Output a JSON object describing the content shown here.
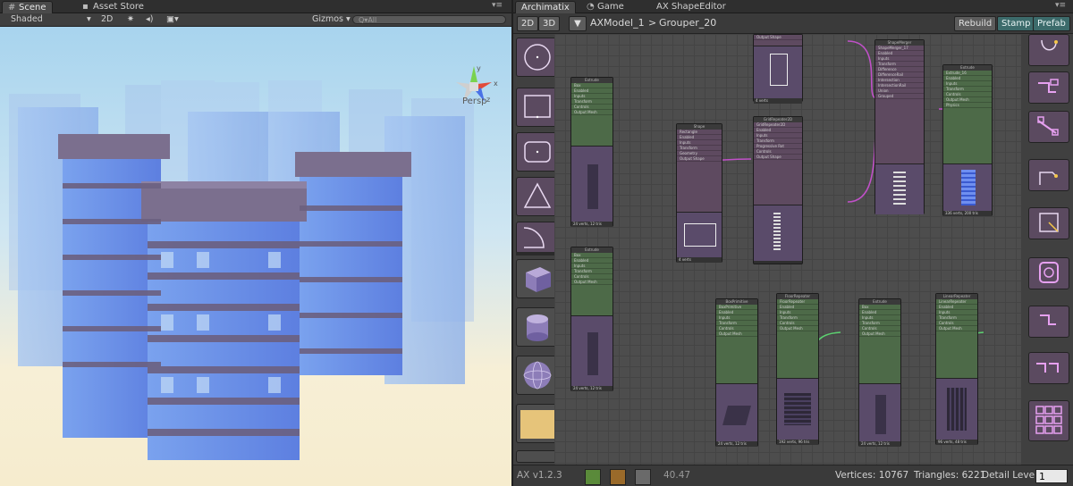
{
  "scene": {
    "tabs": [
      {
        "label": "Scene",
        "icon": "grid-icon"
      },
      {
        "label": "Asset Store",
        "icon": "store-bag-icon"
      }
    ],
    "toolbar": {
      "shading_mode": "Shaded",
      "mode_2d": "2D",
      "gizmos_label": "Gizmos",
      "search_placeholder": "Q▾All"
    },
    "view_label": "Persp",
    "gizmo_axes": [
      "y",
      "x",
      "z"
    ]
  },
  "archimatix": {
    "tabs": [
      {
        "label": "Archimatix"
      },
      {
        "label": "Game",
        "icon": "pacman-icon"
      },
      {
        "label": "AX ShapeEditor"
      }
    ],
    "toolbar": {
      "btn_2d": "2D",
      "btn_3d": "3D",
      "breadcrumb_root": "AXModel_1",
      "breadcrumb_sep": ">",
      "breadcrumb_leaf": "Grouper_20",
      "rebuild": "Rebuild",
      "stamp": "Stamp",
      "prefab": "Prefab"
    },
    "status": {
      "version": "AX v1.2.3",
      "fps": "40.47",
      "vertices": "Vertices: 10767",
      "triangles": "Triangles: 6221",
      "detail_label": "Detail Level",
      "detail_value": "1"
    },
    "colors": {
      "accent_teal": "#3c6b6b",
      "node_green": "#4d6a48",
      "node_purple": "#5e4a60",
      "wire": "#c050c8"
    }
  }
}
